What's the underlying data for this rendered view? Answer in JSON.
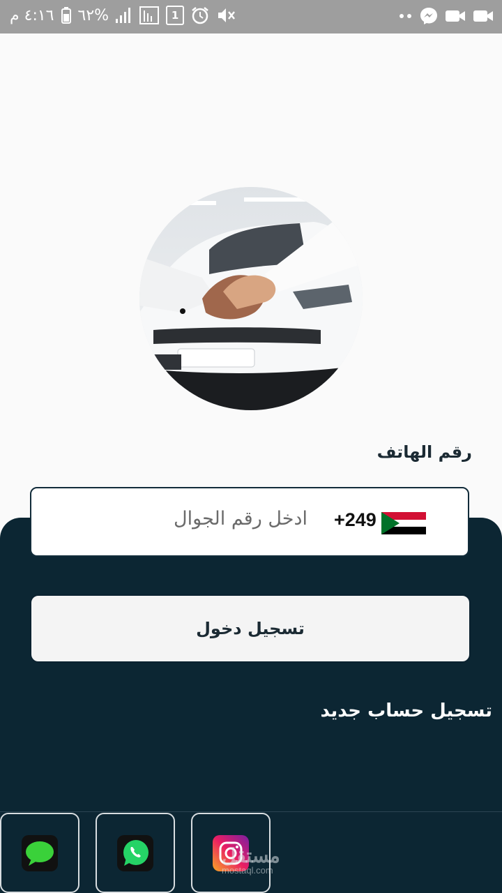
{
  "status_bar": {
    "time": "٤:١٦ م",
    "battery_percent": "٦٢%",
    "sim_badge": "1",
    "icons_left": [
      "battery-icon",
      "signal-icon",
      "data-icon",
      "sim-icon",
      "alarm-icon",
      "mute-icon"
    ],
    "icons_right": [
      "dots-icon",
      "messenger-icon",
      "video-icon",
      "video-icon"
    ]
  },
  "login": {
    "phone_label": "رقم الهاتف",
    "country_code": "+249",
    "phone_placeholder": "ادخل رقم الجوال",
    "login_button": "تسجيل دخول",
    "register_link": "تسجيل حساب جديد"
  },
  "social": {
    "buttons": [
      {
        "name": "messages",
        "icon": "sms-chat-icon"
      },
      {
        "name": "whatsapp",
        "icon": "whatsapp-icon"
      },
      {
        "name": "instagram",
        "icon": "instagram-icon"
      }
    ]
  },
  "watermark": {
    "arabic": "مستقل",
    "latin": "mostaql.com"
  },
  "colors": {
    "panel": "#0c2633",
    "status_bar": "#9e9e9e",
    "whatsapp": "#25d366"
  }
}
